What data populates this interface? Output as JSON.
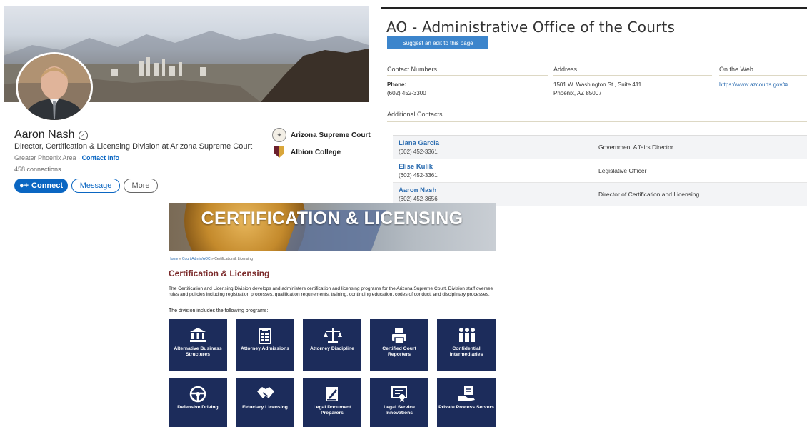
{
  "linkedin": {
    "name": "Aaron Nash",
    "headline": "Director, Certification & Licensing Division at Arizona Supreme Court",
    "location": "Greater Phoenix Area",
    "location_sep": " · ",
    "contact_info": "Contact info",
    "connections": "458 connections",
    "buttons": {
      "connect": "Connect",
      "message": "Message",
      "more": "More"
    },
    "orgs": [
      "Arizona Supreme Court",
      "Albion College"
    ],
    "colors": {
      "accent": "#0a66c2"
    }
  },
  "ao": {
    "title": "AO - Administrative Office of the Courts",
    "suggest_button": "Suggest an edit to this page",
    "columns": [
      "Contact Numbers",
      "Address",
      "On the Web"
    ],
    "phone_label": "Phone:",
    "phone": "(602) 452-3300",
    "address_line1": "1501 W. Washington St., Suite 411",
    "address_line2": "Phoenix, AZ 85007",
    "web": "https://www.azcourts.gov/",
    "additional_contacts": "Additional Contacts",
    "contacts": [
      {
        "name": "Liana Garcia",
        "phone": "(602) 452-3361",
        "title": "Government Affairs Director"
      },
      {
        "name": "Elise Kulik",
        "phone": "(602) 452-3361",
        "title": "Legislative Officer"
      },
      {
        "name": "Aaron Nash",
        "phone": "(602) 452-3656",
        "title": "Director of Certification and Licensing"
      }
    ]
  },
  "cl": {
    "hero_title": "CERTIFICATION & LICENSING",
    "breadcrumb": [
      "Home",
      "Court Admin/AOC",
      "Certification & Licensing"
    ],
    "breadcrumb_sep": " » ",
    "heading": "Certification & Licensing",
    "description": "The Certification and Licensing Division develops and administers certification and licensing programs for the Arizona Supreme Court. Division staff oversee rules and policies including registration processes, qualification requirements, training, continuing education, codes of conduct, and disciplinary processes.",
    "includes": "The division includes the following programs:",
    "tiles": [
      {
        "label": "Alternative Business Structures",
        "icon": "bank-icon"
      },
      {
        "label": "Attorney Admissions",
        "icon": "clipboard-icon"
      },
      {
        "label": "Attorney Discipline",
        "icon": "scales-icon"
      },
      {
        "label": "Certified Court Reporters",
        "icon": "printer-icon"
      },
      {
        "label": "Confidential Intermediaries",
        "icon": "people-icon"
      },
      {
        "label": "Defensive Driving",
        "icon": "steering-wheel-icon"
      },
      {
        "label": "Fiduciary Licensing",
        "icon": "handshake-icon"
      },
      {
        "label": "Legal Document Preparers",
        "icon": "document-pen-icon"
      },
      {
        "label": "Legal Service Innovations",
        "icon": "certificate-icon"
      },
      {
        "label": "Private Process Servers",
        "icon": "hand-document-icon"
      }
    ],
    "colors": {
      "tile": "#1c2c5b",
      "heading": "#7b2a2a"
    }
  }
}
